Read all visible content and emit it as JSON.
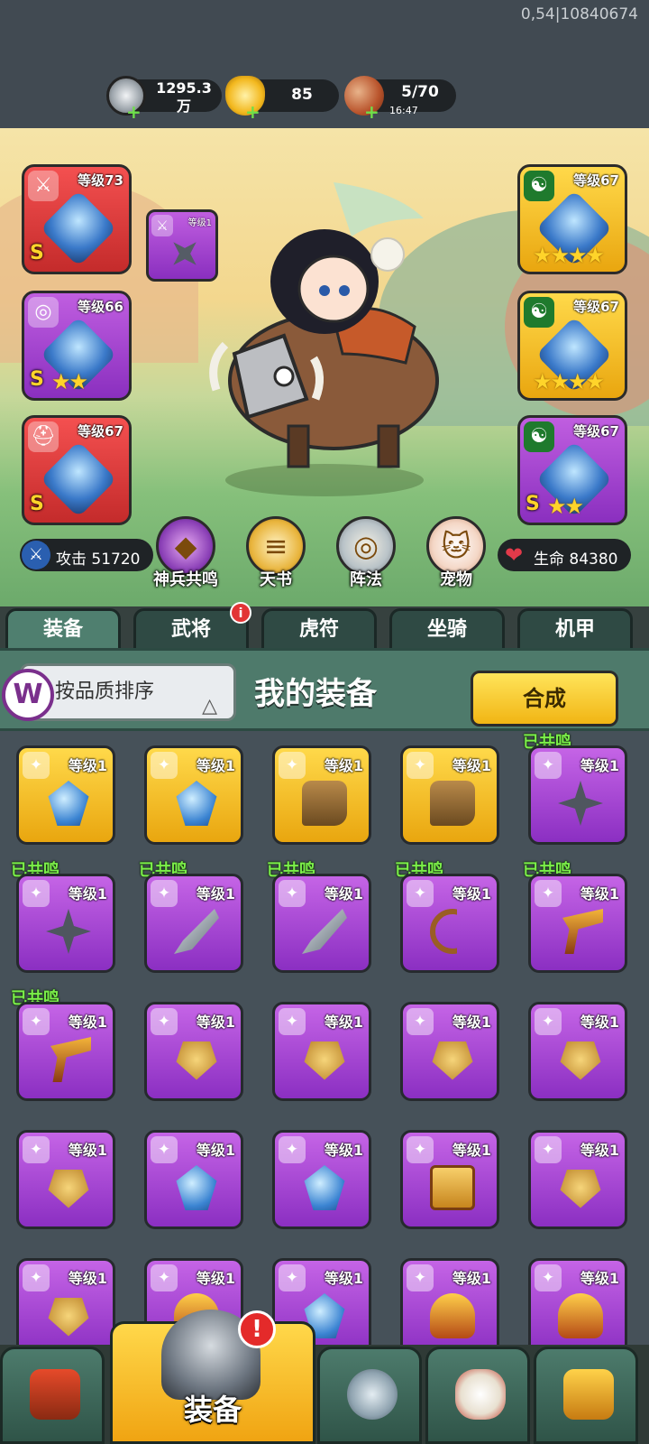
{
  "debug": "0,54|10840674",
  "resources": {
    "silver": {
      "value": "1295.3",
      "unit": "万",
      "icon": "silver-coin-icon"
    },
    "gold": {
      "value": "85",
      "icon": "gold-ingot-icon"
    },
    "stamina": {
      "value": "5/70",
      "timer": "16:47",
      "icon": "meat-icon"
    }
  },
  "equipped": {
    "weapon": {
      "level": "等级73",
      "grade": "S"
    },
    "weapon_mini": {
      "level": "等级1"
    },
    "amulet": {
      "level": "等级66",
      "grade": "S",
      "stars": "★★"
    },
    "helmet": {
      "level": "等级67",
      "grade": "S"
    },
    "armor_right1": {
      "level": "等级67",
      "stars": "★★★★"
    },
    "armor_right2": {
      "level": "等级67",
      "stars": "★★★★"
    },
    "armor_right3": {
      "level": "等级67",
      "grade": "S",
      "stars": "★★"
    }
  },
  "stats": {
    "attack_label": "攻击",
    "attack_value": "51720",
    "hp_label": "生命",
    "hp_value": "84380"
  },
  "features": [
    "神兵共鸣",
    "天书",
    "阵法",
    "宠物"
  ],
  "tabs": [
    {
      "label": "装备",
      "active": true
    },
    {
      "label": "武将",
      "badge": "i"
    },
    {
      "label": "虎符"
    },
    {
      "label": "坐骑"
    },
    {
      "label": "机甲"
    }
  ],
  "panel": {
    "sort_label": "按品质排序",
    "title": "我的装备",
    "merge_label": "合成",
    "logo": "W"
  },
  "resonated_label": "已共鸣",
  "items": [
    {
      "level": "等级1",
      "rarity": "gold",
      "art": "gem"
    },
    {
      "level": "等级1",
      "rarity": "gold",
      "art": "gem"
    },
    {
      "level": "等级1",
      "rarity": "gold",
      "art": "boot"
    },
    {
      "level": "等级1",
      "rarity": "gold",
      "art": "boot"
    },
    {
      "level": "等级1",
      "rarity": "purple",
      "art": "shuriken",
      "resonated": true
    },
    {
      "level": "等级1",
      "rarity": "purple",
      "art": "shuriken",
      "resonated": true
    },
    {
      "level": "等级1",
      "rarity": "purple",
      "art": "blade",
      "resonated": true
    },
    {
      "level": "等级1",
      "rarity": "purple",
      "art": "blade",
      "resonated": true
    },
    {
      "level": "等级1",
      "rarity": "purple",
      "art": "bow",
      "resonated": true
    },
    {
      "level": "等级1",
      "rarity": "purple",
      "art": "gun",
      "resonated": true
    },
    {
      "level": "等级1",
      "rarity": "purple",
      "art": "gun",
      "resonated": true
    },
    {
      "level": "等级1",
      "rarity": "purple",
      "art": "amulet"
    },
    {
      "level": "等级1",
      "rarity": "purple",
      "art": "amulet"
    },
    {
      "level": "等级1",
      "rarity": "purple",
      "art": "amulet"
    },
    {
      "level": "等级1",
      "rarity": "purple",
      "art": "amulet"
    },
    {
      "level": "等级1",
      "rarity": "purple",
      "art": "amulet"
    },
    {
      "level": "等级1",
      "rarity": "purple",
      "art": "gem"
    },
    {
      "level": "等级1",
      "rarity": "purple",
      "art": "gem"
    },
    {
      "level": "等级1",
      "rarity": "purple",
      "art": "scroll"
    },
    {
      "level": "等级1",
      "rarity": "purple",
      "art": "amulet"
    },
    {
      "level": "等级1",
      "rarity": "purple",
      "art": "amulet"
    },
    {
      "level": "等级1",
      "rarity": "purple",
      "art": "helm"
    },
    {
      "level": "等级1",
      "rarity": "purple",
      "art": "gem"
    },
    {
      "level": "等级1",
      "rarity": "purple",
      "art": "helm"
    },
    {
      "level": "等级1",
      "rarity": "purple",
      "art": "helm"
    }
  ],
  "bottom_nav": [
    {
      "icon": "gate-icon"
    },
    {
      "label": "装备",
      "icon": "helmet-icon",
      "active": true,
      "alert": "!"
    },
    {
      "icon": "swords-icon"
    },
    {
      "icon": "rooster-icon"
    },
    {
      "icon": "upgrade-icon"
    }
  ]
}
